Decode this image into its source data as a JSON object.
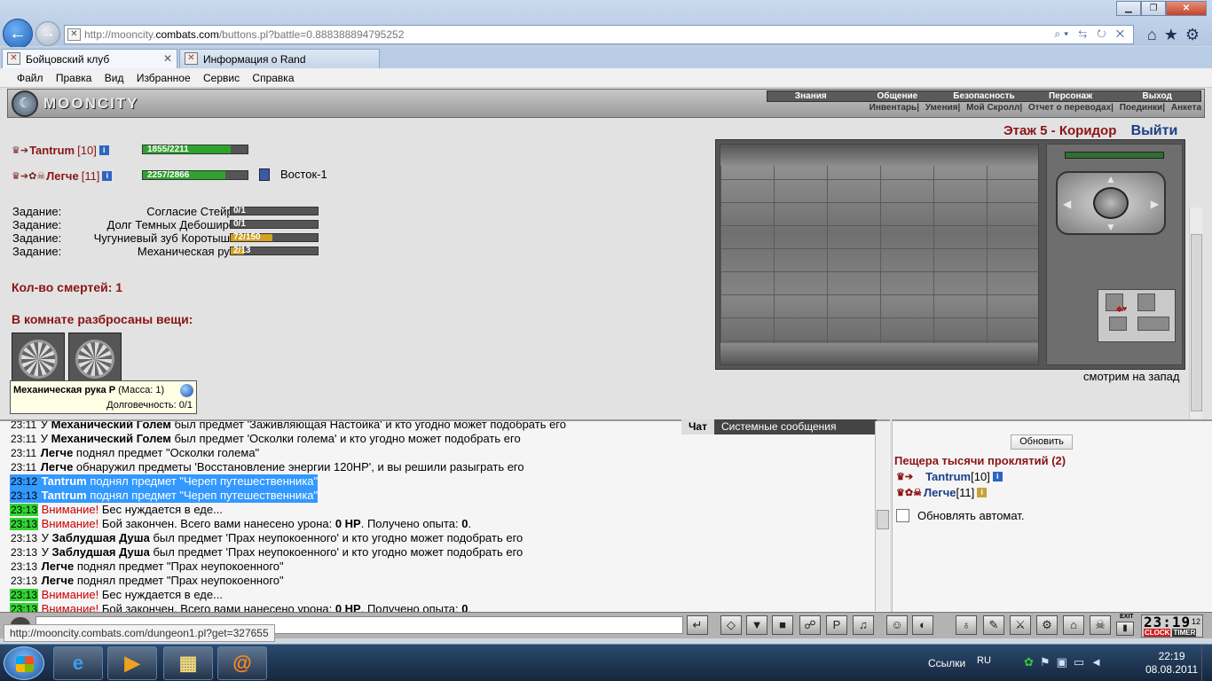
{
  "browser": {
    "url_prefix": "http://mooncity.",
    "url_domain": "combats.com",
    "url_path": "/buttons.pl?battle=0.888388894795252",
    "addr_tools": "⌕▾ ⇆ ↻ ✕",
    "tabs": [
      {
        "label": "Бойцовский клуб",
        "active": true
      },
      {
        "label": "Информация о Rand",
        "active": false
      }
    ],
    "menu": [
      "Файл",
      "Правка",
      "Вид",
      "Избранное",
      "Сервис",
      "Справка"
    ],
    "status_url": "http://mooncity.combats.com/dungeon1.pl?get=327655"
  },
  "game": {
    "logo": "MOONCITY",
    "main_menu": [
      "Знания",
      "Общение",
      "Безопасность",
      "Персонаж",
      "Выход"
    ],
    "sub_menu": [
      "Инвентарь",
      "Умения",
      "Мой Скролл",
      "Отчет о переводах",
      "Поединки",
      "Анкета"
    ],
    "players": [
      {
        "name": "Tantrum",
        "level": "[10]",
        "hp": "1855/2211",
        "hp_frac": 0.839
      },
      {
        "name": "Легче",
        "level": "[11]",
        "hp": "2257/2866",
        "hp_frac": 0.787
      }
    ],
    "location": "Восток-1",
    "tasks": [
      {
        "label": "Задание:",
        "name": "Согласие Стейры",
        "progress": "0/1",
        "frac": 0
      },
      {
        "label": "Задание:",
        "name": "Долг Темных Дебоширов",
        "progress": "0/1",
        "frac": 0
      },
      {
        "label": "Задание:",
        "name": "Чугуниевый зуб Коротышки",
        "progress": "72/150",
        "frac": 0.48
      },
      {
        "label": "Задание:",
        "name": "Механическая рука",
        "progress": "2/13",
        "frac": 0.154
      }
    ],
    "deaths": "Кол-во смертей: 1",
    "items_header": "В комнате разбросаны вещи:",
    "tooltip": {
      "name": "Механическая рука Р",
      "mass": "(Масса: 1)",
      "durability": "Долговечность: 0/1"
    },
    "dungeon_title": "Этаж 5 - Коридор",
    "exit": "Выйти",
    "look": "смотрим на запад"
  },
  "chat": {
    "tabs": [
      "Чат",
      "Системные сообщения"
    ],
    "lines": [
      {
        "time": "23:11",
        "green": false,
        "sel": false,
        "prefix": "У ",
        "name": "Механический Голем",
        "text": " был предмет 'Заживляющая Настойка' и кто угодно может подобрать его"
      },
      {
        "time": "23:11",
        "green": false,
        "sel": false,
        "prefix": "У ",
        "name": "Механический Голем",
        "text": " был предмет 'Осколки голема' и кто угодно может подобрать его"
      },
      {
        "time": "23:11",
        "green": false,
        "sel": false,
        "prefix": "",
        "name": "Легче",
        "text": " поднял предмет \"Осколки голема\""
      },
      {
        "time": "23:11",
        "green": false,
        "sel": false,
        "prefix": "",
        "name": "Легче",
        "text": " обнаружил предметы 'Восстановление энергии 120HP', и вы решили разыграть его"
      },
      {
        "time": "23:12",
        "green": false,
        "sel": true,
        "prefix": "",
        "name": "Tantrum",
        "text": " поднял предмет \"Череп путешественника\""
      },
      {
        "time": "23:13",
        "green": false,
        "sel": true,
        "prefix": "",
        "name": "Tantrum",
        "text": " поднял предмет \"Череп путешественника\""
      },
      {
        "time": "23:13",
        "green": true,
        "sel": false,
        "warn": "Внимание!",
        "text": " Бес нуждается в еде..."
      },
      {
        "time": "23:13",
        "green": true,
        "sel": false,
        "warn": "Внимание!",
        "text": " Бой закончен. Всего вами нанесено урона: ",
        "b1": "0 HP",
        "text2": ". Получено опыта: ",
        "b2": "0",
        "text3": "."
      },
      {
        "time": "23:13",
        "green": false,
        "sel": false,
        "prefix": "У ",
        "name": "Заблудшая Душа",
        "text": " был предмет 'Прах неупокоенного' и кто угодно может подобрать его"
      },
      {
        "time": "23:13",
        "green": false,
        "sel": false,
        "prefix": "У ",
        "name": "Заблудшая Душа",
        "text": " был предмет 'Прах неупокоенного' и кто угодно может подобрать его"
      },
      {
        "time": "23:13",
        "green": false,
        "sel": false,
        "prefix": "",
        "name": "Легче",
        "text": " поднял предмет \"Прах неупокоенного\""
      },
      {
        "time": "23:13",
        "green": false,
        "sel": false,
        "prefix": "",
        "name": "Легче",
        "text": " поднял предмет \"Прах неупокоенного\""
      },
      {
        "time": "23:13",
        "green": true,
        "sel": false,
        "warn": "Внимание!",
        "text": " Бес нуждается в еде..."
      },
      {
        "time": "23:13",
        "green": true,
        "sel": false,
        "warn": "Внимание!",
        "text": " Бой закончен. Всего вами нанесено урона: ",
        "b1": "0 HP",
        "text2": ". Получено опыта: ",
        "b2": "0",
        "text3": "."
      }
    ]
  },
  "room": {
    "refresh": "Обновить",
    "name": "Пещера тысячи проклятий (2)",
    "players": [
      {
        "name": "Tantrum",
        "level": "[10]"
      },
      {
        "name": "Легче",
        "level": "[11]"
      }
    ],
    "auto": "Обновлять автомат."
  },
  "toolbar": {
    "clock": "23:19",
    "clock_sec": "12",
    "clock_label": "CLOCK",
    "timer_label": "TIMER",
    "exit_label": "EXIT"
  },
  "taskbar": {
    "links": "Ссылки",
    "lang": "RU",
    "time": "22:19",
    "date": "08.08.2011"
  }
}
